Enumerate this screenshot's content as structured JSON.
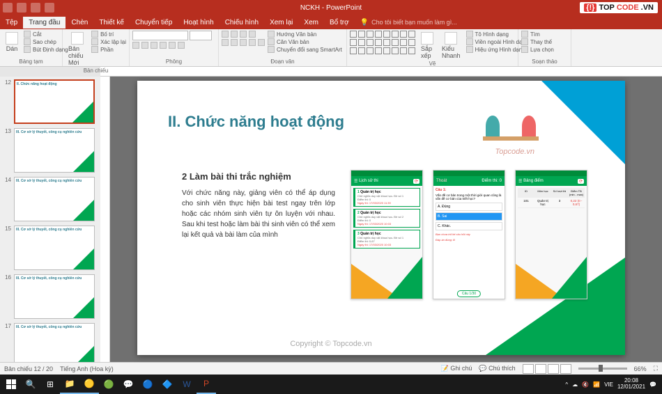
{
  "window": {
    "title": "NCKH - PowerPoint"
  },
  "menu": {
    "tabs": [
      "Tệp",
      "Trang đầu",
      "Chèn",
      "Thiết kế",
      "Chuyển tiếp",
      "Hoạt hình",
      "Chiếu hình",
      "Xem lại",
      "Xem",
      "Bổ trợ"
    ],
    "active": 1,
    "tell_me": "Cho tôi biết bạn muốn làm gì..."
  },
  "ribbon": {
    "clipboard": {
      "label": "Bảng tạm",
      "paste": "Dán",
      "cut": "Cắt",
      "copy": "Sao chép",
      "fmt": "Bút Định dạng"
    },
    "slides": {
      "label": "Bản chiếu",
      "new": "Bản chiếu Mới",
      "layout": "Bố trí",
      "reset": "Xác lập lại",
      "section": "Phần"
    },
    "font": {
      "label": "Phông"
    },
    "para": {
      "label": "Đoạn văn"
    },
    "drawing": {
      "label": "Vẽ",
      "arrange": "Sắp xếp",
      "quick": "Kiểu Nhanh",
      "l1": "Tô Hình dạng",
      "l2": "Viền ngoài Hình dạng",
      "l3": "Hiệu ứng Hình dạng"
    },
    "editing": {
      "label": "Soạn thảo",
      "find": "Tìm",
      "replace": "Thay thế",
      "select": "Lựa chọn"
    },
    "para_extra": {
      "l1": "Hướng Văn bản",
      "l2": "Căn Văn bản",
      "l3": "Chuyển đổi sang SmartArt"
    }
  },
  "thumbs": [
    {
      "n": "12",
      "title": "II. Chức năng hoạt động",
      "active": true
    },
    {
      "n": "13",
      "title": "III. Cơ sở lý thuyết, công cụ nghiên cứu"
    },
    {
      "n": "14",
      "title": "III. Cơ sở lý thuyết, công cụ nghiên cứu"
    },
    {
      "n": "15",
      "title": "III. Cơ sở lý thuyết, công cụ nghiên cứu"
    },
    {
      "n": "16",
      "title": "III. Cơ sở lý thuyết, công cụ nghiên cứu"
    },
    {
      "n": "17",
      "title": "III. Cơ sở lý thuyết, công cụ nghiên cứu"
    }
  ],
  "slide": {
    "h1": "II. Chức năng hoạt động",
    "h2": "2 Làm bài thi trắc nghiệm",
    "body": "Với chức năng này, giảng viên có thể áp dụng cho sinh viên thực hiện bài test ngay trên lớp hoặc các nhóm sinh viên tự ôn luyện với nhau. Sau khi test hoặc làm bài thi sinh viên có thể xem lại kết quả và bài làm của mình",
    "wm": "Topcode.vn",
    "phone1": {
      "title": "Lịch sử thi",
      "items": [
        {
          "n": "1",
          "t": "Quản trị học",
          "s": "Chủ nghĩa duy vật khoa học- Đề số 1",
          "sc": "Điểm thi: 0",
          "d": "Ngày thi: 17/03/2020 11:39"
        },
        {
          "n": "2",
          "t": "Quản trị học",
          "s": "Chủ nghĩa duy vật khoa học- Đề số 2",
          "sc": "Điểm thi: 0",
          "d": "Ngày thi: 17/03/2020 10:03"
        },
        {
          "n": "3",
          "t": "Quản trị học",
          "s": "Chủ nghĩa duy vật khoa học- Đề số 1",
          "sc": "Điểm thi: 0,67",
          "d": "Ngày thi: 17/03/2020 10:03"
        }
      ]
    },
    "phone2": {
      "back": "Thoát",
      "score": "Điểm thi: 0",
      "qn": "Câu 1:",
      "qt": "Vấn đề cơ bản trong một thời giới quan cũng là vấn đề cơ bản của triết học?",
      "a": "A. Đúng",
      "b": "B. Sai",
      "c": "C. Khác.",
      "ans1": "Bạn chưa trả lời câu hỏi này",
      "ans2": "Đáp án đúng: B",
      "nav": "Câu 1/30"
    },
    "phone3": {
      "title": "Bảng điểm",
      "cols": [
        "ID",
        "Môn học",
        "Số lượt thi",
        "Điểm TB (min - max)"
      ],
      "row": [
        "101",
        "Quản trị học",
        "3",
        "0,22 (0 - 0,67)"
      ]
    }
  },
  "status": {
    "slide": "Bản chiếu 12 / 20",
    "lang": "Tiếng Anh (Hoa kỳ)",
    "notes": "Ghi chú",
    "comments": "Chú thích",
    "zoom": "66%"
  },
  "tray": {
    "lang": "VIE",
    "time": "20:08",
    "date": "12/01/2021"
  },
  "watermark": "Copyright © Topcode.vn",
  "brand": {
    "pre": "{!}",
    "t1": "TOP",
    "t2": "CODE",
    "suf": ".VN"
  }
}
